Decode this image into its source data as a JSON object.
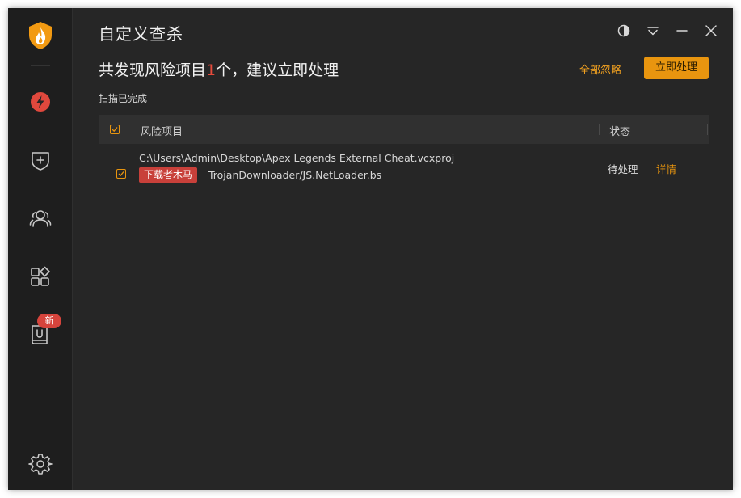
{
  "window": {
    "title": "自定义查杀"
  },
  "sidebar": {
    "logo_icon": "shield-flame-logo",
    "items": [
      {
        "icon": "lightning-icon",
        "name": "quick-scan"
      },
      {
        "icon": "shield-plus-icon",
        "name": "protection"
      },
      {
        "icon": "users-icon",
        "name": "users"
      },
      {
        "icon": "apps-icon",
        "name": "tools"
      },
      {
        "icon": "book-icon",
        "name": "news",
        "badge": "新"
      }
    ],
    "settings_icon": "gear-icon"
  },
  "header": {
    "headline_prefix": "共发现风险项目",
    "headline_count": "1",
    "headline_suffix": "个，建议立即处理",
    "ignore_all": "全部忽略",
    "handle_now": "立即处理",
    "scan_status": "扫描已完成"
  },
  "table": {
    "col_item": "风险项目",
    "col_status": "状态",
    "rows": [
      {
        "checked": true,
        "path": "C:\\Users\\Admin\\Desktop\\Apex Legends External Cheat.vcxproj",
        "tag": "下载者木马",
        "virus_name": "TrojanDownloader/JS.NetLoader.bs",
        "status": "待处理",
        "action": "详情"
      }
    ]
  },
  "colors": {
    "accent": "#e8950f",
    "danger": "#d6443c",
    "background": "#262626",
    "sidebar": "#1e1e1e"
  }
}
